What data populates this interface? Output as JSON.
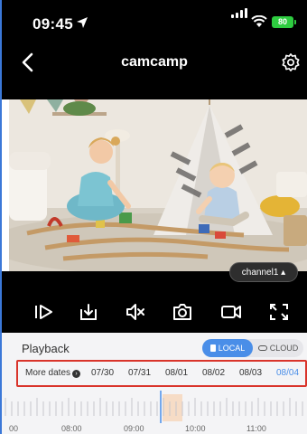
{
  "status_bar": {
    "time": "09:45",
    "battery": "80"
  },
  "nav": {
    "title": "camcamp"
  },
  "video": {
    "channel_label": "channel1 ▴"
  },
  "controls": [
    "play-step-icon",
    "download-icon",
    "mute-icon",
    "snapshot-icon",
    "record-icon",
    "fullscreen-icon"
  ],
  "playback": {
    "title": "Playback",
    "local_label": "LOCAL",
    "cloud_label": "CLOUD",
    "more_dates_label": "More dates",
    "dates": [
      "07/30",
      "07/31",
      "08/01",
      "08/02",
      "08/03",
      "08/04"
    ],
    "active_date": "08/04"
  },
  "timeline": {
    "labels": [
      "00",
      "08:00",
      "09:00",
      "10:00",
      "11:00"
    ]
  },
  "colors": {
    "accent": "#4a8ee8",
    "highlight_border": "#d9342b",
    "battery": "#2ecc40"
  }
}
